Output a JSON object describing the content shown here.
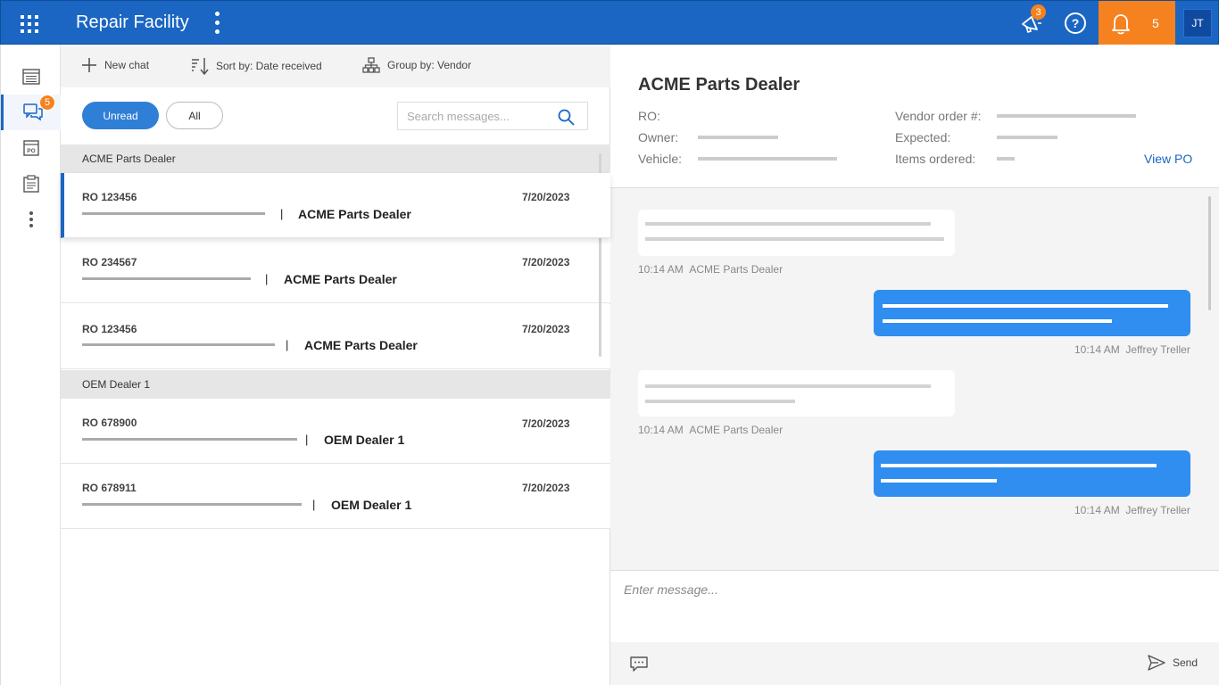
{
  "app": {
    "title": "Repair Facility"
  },
  "topbar": {
    "announcements_badge": "3",
    "notifications_count": "5",
    "avatar_initials": "JT",
    "brand_color": "#1a66c2",
    "accent_color": "#f5821f"
  },
  "rail": {
    "messages_badge": "5"
  },
  "toolbar": {
    "new_chat": "New chat",
    "sort_by": "Sort by: Date received",
    "group_by": "Group by: Vendor"
  },
  "filters": {
    "unread": "Unread",
    "all": "All",
    "search_placeholder": "Search messages..."
  },
  "groups": [
    {
      "name": "ACME Parts Dealer"
    },
    {
      "name": "OEM Dealer 1"
    }
  ],
  "threads": [
    {
      "ro": "RO 123456",
      "date": "7/20/2023",
      "vendor": "ACME Parts Dealer",
      "sep": "|"
    },
    {
      "ro": "RO 234567",
      "date": "7/20/2023",
      "vendor": "ACME Parts Dealer",
      "sep": "|"
    },
    {
      "ro": "RO 123456",
      "date": "7/20/2023",
      "vendor": "ACME Parts Dealer",
      "sep": "|"
    },
    {
      "ro": "RO 678900",
      "date": "7/20/2023",
      "vendor": "OEM Dealer 1",
      "sep": "|"
    },
    {
      "ro": "RO 678911",
      "date": "7/20/2023",
      "vendor": "OEM Dealer 1",
      "sep": "|"
    }
  ],
  "chat": {
    "title": "ACME Parts Dealer",
    "labels": {
      "ro": "RO:",
      "owner": "Owner:",
      "vehicle": "Vehicle:",
      "vendor_order": "Vendor order #:",
      "expected": "Expected:",
      "items_ordered": "Items ordered:"
    },
    "view_po": "View PO",
    "messages": [
      {
        "time": "10:14 AM",
        "author": "ACME Parts Dealer",
        "direction": "in"
      },
      {
        "time": "10:14 AM",
        "author": "Jeffrey Treller",
        "direction": "out"
      },
      {
        "time": "10:14 AM",
        "author": "ACME Parts Dealer",
        "direction": "in"
      },
      {
        "time": "10:14 AM",
        "author": "Jeffrey Treller",
        "direction": "out"
      }
    ],
    "composer_placeholder": "Enter message...",
    "send": "Send"
  }
}
